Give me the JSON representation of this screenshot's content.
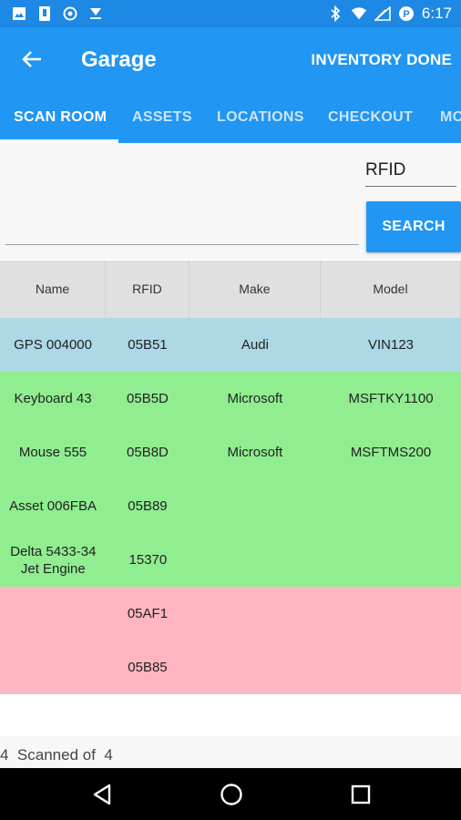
{
  "status_bar": {
    "time": "6:17",
    "left_icons": [
      "image-icon",
      "sim-icon",
      "record-icon",
      "download-icon"
    ],
    "right_icons": [
      "bluetooth-icon",
      "wifi-icon",
      "signal-icon",
      "alarm-icon"
    ]
  },
  "app_bar": {
    "title": "Garage",
    "action": "INVENTORY DONE"
  },
  "tabs": [
    {
      "label": "SCAN ROOM",
      "active": true
    },
    {
      "label": "ASSETS",
      "active": false
    },
    {
      "label": "LOCATIONS",
      "active": false
    },
    {
      "label": "CHECKOUT",
      "active": false
    },
    {
      "label": "MO",
      "active": false
    }
  ],
  "search": {
    "input_value": "",
    "field_select": "RFID",
    "button_label": "SEARCH"
  },
  "table": {
    "headers": [
      "Name",
      "RFID",
      "Make",
      "Model"
    ],
    "rows": [
      {
        "status": "blue",
        "name": "GPS 004000",
        "rfid": "05B51",
        "make": "Audi",
        "model": "VIN123"
      },
      {
        "status": "green",
        "name": "Keyboard 43",
        "rfid": "05B5D",
        "make": "Microsoft",
        "model": "MSFTKY1100"
      },
      {
        "status": "green",
        "name": "Mouse 555",
        "rfid": "05B8D",
        "make": "Microsoft",
        "model": "MSFTMS200"
      },
      {
        "status": "green",
        "name": "Asset 006FBA",
        "rfid": "05B89",
        "make": "",
        "model": ""
      },
      {
        "status": "green",
        "name": "Delta 5433-34 Jet Engine",
        "rfid": "15370",
        "make": "",
        "model": ""
      },
      {
        "status": "pink",
        "name": "",
        "rfid": "05AF1",
        "make": "",
        "model": ""
      },
      {
        "status": "pink",
        "name": "",
        "rfid": "05B85",
        "make": "",
        "model": ""
      }
    ],
    "colors": {
      "blue": "#add8e6",
      "green": "#90ee90",
      "pink": "#ffb6c1"
    }
  },
  "footer": {
    "scanned": "4",
    "scanned_label": "Scanned of",
    "total": "4"
  },
  "nav_bar": {
    "buttons": [
      "back-triangle-icon",
      "home-circle-icon",
      "recents-square-icon"
    ]
  },
  "colors": {
    "primary": "#2196f3",
    "status_bar": "#1e88e5"
  }
}
